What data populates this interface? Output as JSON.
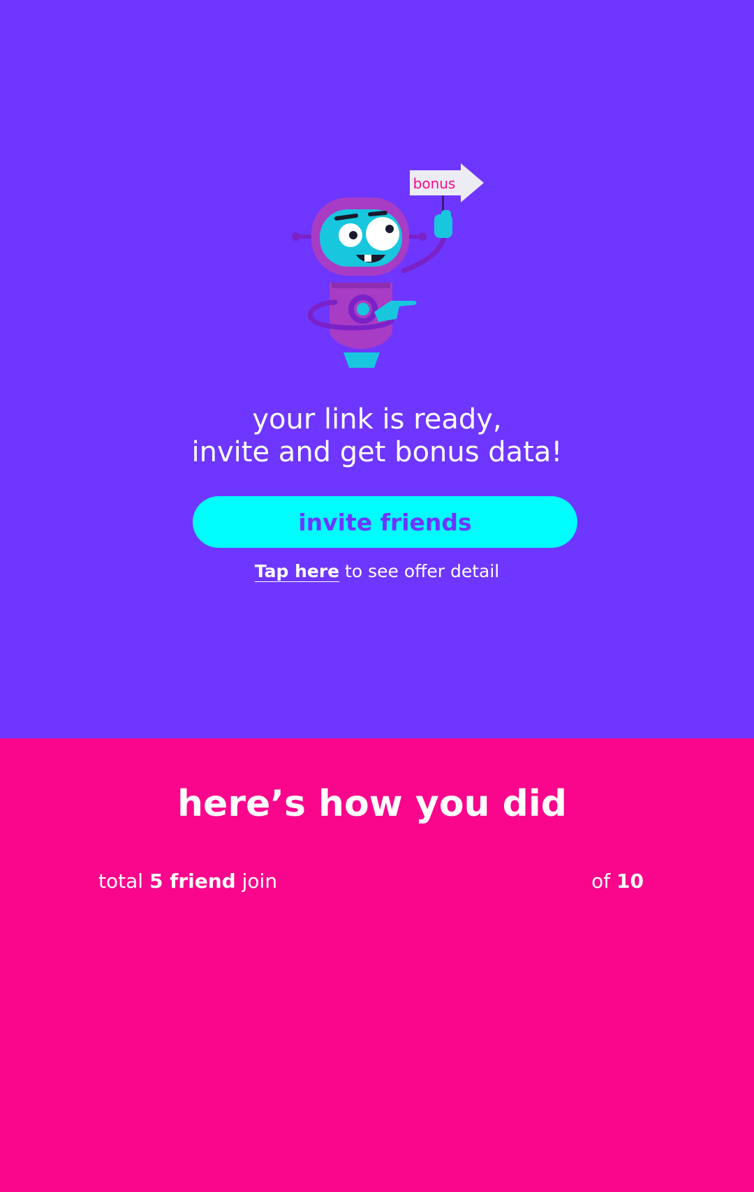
{
  "colors": {
    "top_background": "#6e36ff",
    "bottom_background": "#f9068c",
    "button_background": "#00fdfd",
    "button_text": "#6e36ff",
    "sign_text": "#f9068c"
  },
  "hero": {
    "mascot_icon": "robot-holding-bonus-sign-icon",
    "sign_label": "bonus",
    "headline_line1": "your link is ready,",
    "headline_line2": "invite and get bonus data!",
    "invite_button_label": "invite friends",
    "tap_link_label": "Tap here",
    "offer_suffix": " to see offer detail"
  },
  "results": {
    "title": "here’s how you did",
    "total_prefix": "total ",
    "friend_count_label": "5 friend",
    "total_suffix": " join",
    "of_prefix": "of ",
    "target_count": "10"
  }
}
